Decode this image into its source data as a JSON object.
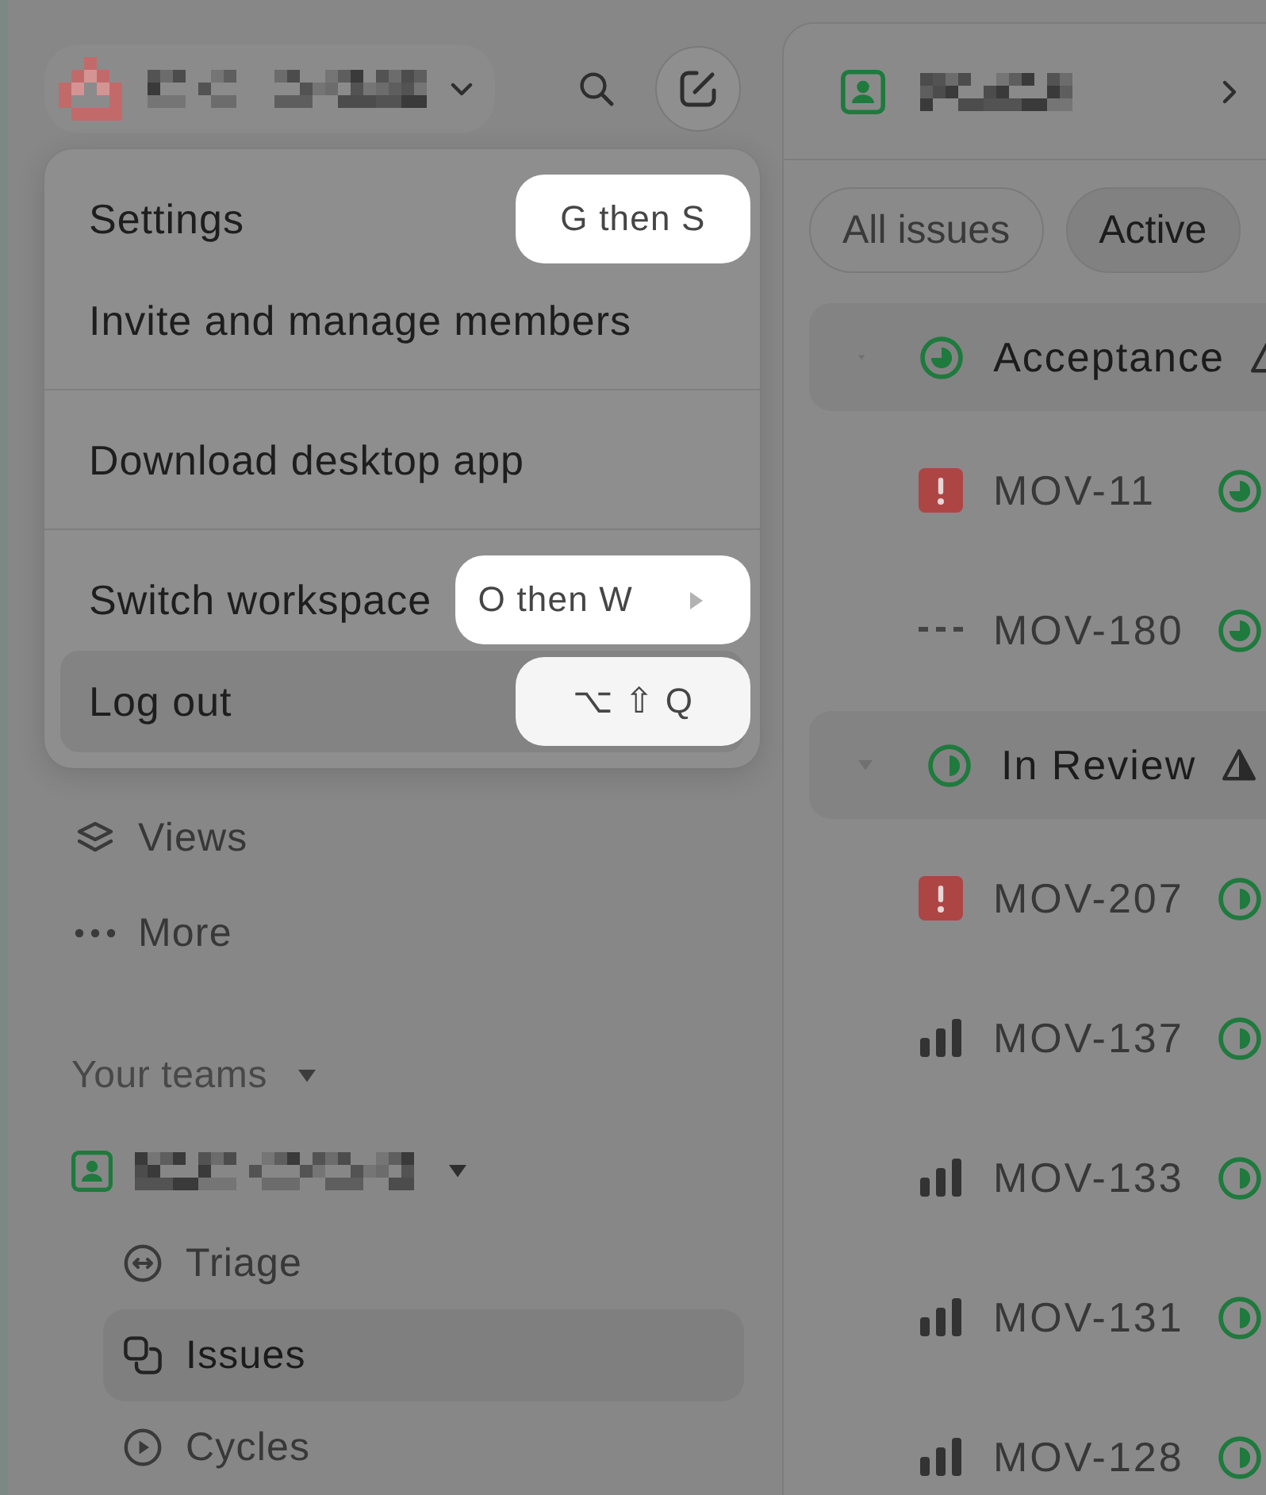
{
  "workspace_switcher": {
    "name_hidden": true
  },
  "account_menu": {
    "open": true,
    "sections": [
      [
        {
          "label": "Settings",
          "shortcut": "G then S",
          "submenu": false,
          "hovered": false
        },
        {
          "label": "Invite and manage members",
          "submenu": false,
          "hovered": false
        }
      ],
      [
        {
          "label": "Download desktop app",
          "submenu": false,
          "hovered": false
        }
      ],
      [
        {
          "label": "Switch workspace",
          "shortcut": "O then W",
          "submenu": true,
          "hovered": false
        },
        {
          "label": "Log out",
          "shortcut": "⌥ ⇧ Q",
          "submenu": false,
          "hovered": true
        }
      ]
    ]
  },
  "sidebar": {
    "nav": [
      {
        "label": "Views",
        "selected": false
      },
      {
        "label": "More",
        "selected": false
      }
    ],
    "teams_section": {
      "title": "Your teams",
      "expanded": true,
      "teams": [
        {
          "name_hidden": true,
          "expanded": true,
          "items": [
            {
              "label": "Triage",
              "selected": false
            },
            {
              "label": "Issues",
              "selected": true
            },
            {
              "label": "Cycles",
              "selected": false
            }
          ]
        }
      ]
    }
  },
  "main": {
    "header": {
      "team_name_hidden": true
    },
    "tabs": [
      {
        "label": "All issues",
        "selected": false
      },
      {
        "label": "Active",
        "selected": true
      }
    ],
    "groups": [
      {
        "name": "Acceptance",
        "kind": "acceptance",
        "expanded": true,
        "alert": true,
        "issues": [
          {
            "id": "MOV-11",
            "kind": "urgent"
          },
          {
            "id": "MOV-180",
            "kind": "none"
          }
        ]
      },
      {
        "name": "In Review",
        "kind": "review",
        "expanded": true,
        "alert": true,
        "issues": [
          {
            "id": "MOV-207",
            "kind": "urgent"
          },
          {
            "id": "MOV-137",
            "kind": "high"
          },
          {
            "id": "MOV-133",
            "kind": "high"
          },
          {
            "id": "MOV-131",
            "kind": "high"
          },
          {
            "id": "MOV-128",
            "kind": "high"
          }
        ]
      }
    ]
  }
}
